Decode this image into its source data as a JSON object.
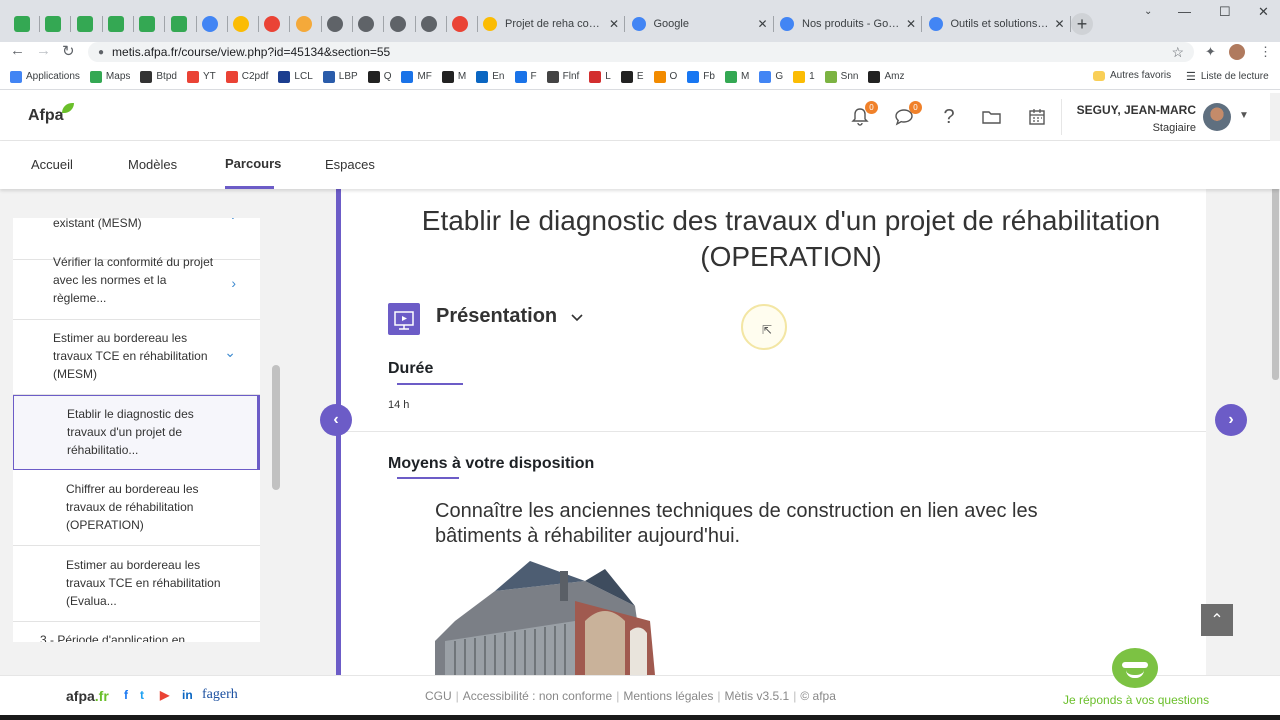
{
  "browser": {
    "pinned_tab_colors": [
      "#34a853",
      "#34a853",
      "#34a853",
      "#34a853",
      "#34a853",
      "#34a853",
      "#4285f4",
      "#fbbc04",
      "#ea4335",
      "#f4a93a",
      "#5f6368",
      "#5f6368",
      "#5f6368",
      "#5f6368",
      "#ea4335"
    ],
    "tabs": [
      {
        "label": "Projet de reha consign",
        "color": "#fbbc04"
      },
      {
        "label": "Google",
        "color": "#4285f4"
      },
      {
        "label": "Nos produits - Google",
        "color": "#4285f4"
      },
      {
        "label": "Outils et solutions d'a",
        "color": "#4285f4"
      }
    ],
    "new_tab": "+",
    "window_controls": {
      "minimize": "—",
      "maximize": "☐",
      "close": "✕"
    },
    "url": "metis.afpa.fr/course/view.php?id=45134&section=55",
    "bookmarks": [
      {
        "label": "Applications",
        "color": "#4285f4"
      },
      {
        "label": "Maps",
        "color": "#34a853"
      },
      {
        "label": "Btpd",
        "color": "#333333"
      },
      {
        "label": "YT",
        "color": "#ea4335"
      },
      {
        "label": "C2pdf",
        "color": "#ea4335"
      },
      {
        "label": "LCL",
        "color": "#1b3d8f"
      },
      {
        "label": "LBP",
        "color": "#2a5caa"
      },
      {
        "label": "Q",
        "color": "#222222"
      },
      {
        "label": "MF",
        "color": "#1a73e8"
      },
      {
        "label": "M",
        "color": "#222222"
      },
      {
        "label": "En",
        "color": "#0a66c2"
      },
      {
        "label": "F",
        "color": "#1a73e8"
      },
      {
        "label": "Flnf",
        "color": "#444444"
      },
      {
        "label": "L",
        "color": "#d32f2f"
      },
      {
        "label": "E",
        "color": "#222222"
      },
      {
        "label": "O",
        "color": "#f28b00"
      },
      {
        "label": "Fb",
        "color": "#1877f2"
      },
      {
        "label": "M",
        "color": "#34a853"
      },
      {
        "label": "G",
        "color": "#4285f4"
      },
      {
        "label": "1",
        "color": "#fbbc04"
      },
      {
        "label": "Snn",
        "color": "#7cb342"
      },
      {
        "label": "Amz",
        "color": "#222222"
      }
    ],
    "other_bookmarks": "Autres favoris",
    "reading_list": "Liste de lecture"
  },
  "header": {
    "logo": "Afpa",
    "notifications_count": "0",
    "messages_count": "0",
    "help_icon": "?",
    "user_name": "SEGUY, JEAN-MARC",
    "user_role": "Stagiaire"
  },
  "nav": {
    "items": [
      "Accueil",
      "Modèles",
      "Parcours",
      "Espaces"
    ],
    "active": "Parcours"
  },
  "sidebar": {
    "items": [
      {
        "text": "existant (MESM)",
        "chevron": "›"
      },
      {
        "text": "Vérifier la conformité du projet avec les normes et la règleme...",
        "chevron": "›"
      },
      {
        "text": "Estimer au bordereau les travaux TCE en réhabilitation (MESM)",
        "chevron": "⌄"
      },
      {
        "text": "Etablir le diagnostic des travaux d'un projet de réhabilitatio...",
        "chevron": ""
      },
      {
        "text": "Chiffrer au bordereau les travaux de réhabilitation (OPERATION)",
        "chevron": ""
      },
      {
        "text": "Estimer au bordereau les travaux TCE en réhabilitation (Evalua...",
        "chevron": ""
      },
      {
        "text": "3 - Période d'application en",
        "chevron": ""
      }
    ]
  },
  "main": {
    "title": "Etablir le diagnostic des travaux d'un projet de réhabilitation (OPERATION)",
    "section_title": "Présentation",
    "duration_heading": "Durée",
    "duration_value": "14 h",
    "means_heading": "Moyens à votre disposition",
    "means_text": "Connaître les anciennes techniques de construction en lien avec les bâtiments à réhabiliter aujourd'hui.",
    "prev_arrow": "‹",
    "next_arrow": "›",
    "back_to_top": "⌃"
  },
  "footer": {
    "logo_main": "afpa",
    "logo_suffix": ".fr",
    "links": [
      "CGU",
      "Accessibilité : non conforme",
      "Mentions légales",
      "Mètis v3.5.1",
      "© afpa"
    ],
    "chatbot_label": "Je réponds à vos questions",
    "social": [
      {
        "glyph": "f",
        "color": "#1877f2"
      },
      {
        "glyph": "t",
        "color": "#1da1f2"
      },
      {
        "glyph": "▶",
        "color": "#ea4335"
      },
      {
        "glyph": "in",
        "color": "#0a66c2"
      }
    ],
    "partner_logo": "fagerh"
  }
}
